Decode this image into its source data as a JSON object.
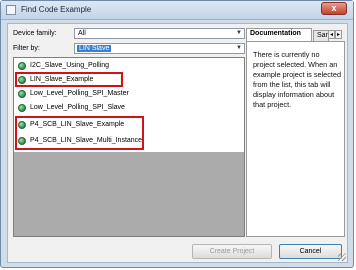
{
  "window": {
    "title": "Find Code Example",
    "close_label": "x"
  },
  "filters": {
    "device_family_label": "Device family:",
    "device_family_value": "All",
    "filter_by_label": "Filter by:",
    "filter_by_value": "LIN Slave"
  },
  "examples": [
    {
      "label": "I2C_Slave_Using_Polling",
      "highlighted": false
    },
    {
      "label": "LIN_Slave_Example",
      "highlighted": true
    },
    {
      "label": "Low_Level_Polling_SPI_Master",
      "highlighted": false
    },
    {
      "label": "Low_Level_Polling_SPI_Slave",
      "highlighted": false
    },
    {
      "label": "P4_SCB_LIN_Slave_Example",
      "highlighted": true
    },
    {
      "label": "P4_SCB_LIN_Slave_Multi_Instance",
      "highlighted": true
    }
  ],
  "tabs": {
    "documentation": "Documentation",
    "sample": "Sam"
  },
  "documentation_text": "There is currently no project selected. When an example project is selected from the list, this tab will display information about that project.",
  "buttons": {
    "create": "Create Project",
    "cancel": "Cancel"
  },
  "colors": {
    "highlight_box": "#d0121b",
    "selection": "#3a7fd6"
  }
}
